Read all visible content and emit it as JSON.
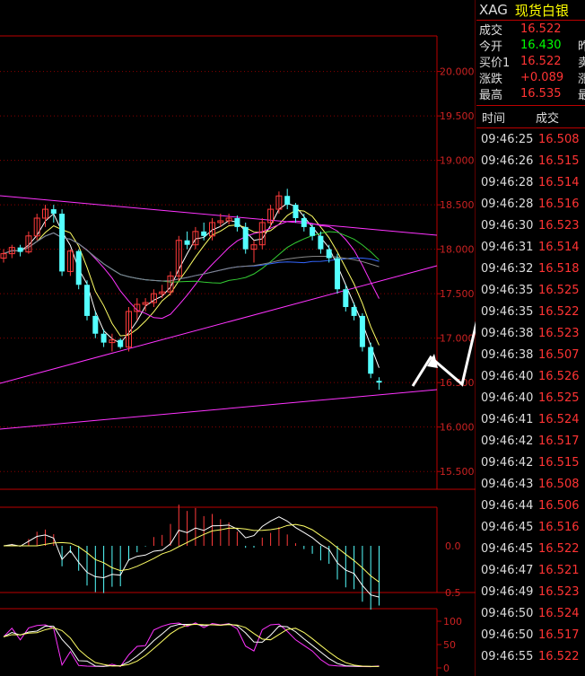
{
  "header": {
    "symbol": "XAG",
    "name": "现货白银"
  },
  "quote": [
    {
      "label": "成交",
      "value": "16.522",
      "color": "red",
      "extra": "",
      "name": "last"
    },
    {
      "label": "今开",
      "value": "16.430",
      "color": "green",
      "extra": "昨",
      "name": "open"
    },
    {
      "label": "买价1",
      "value": "16.522",
      "color": "red",
      "extra": "卖",
      "name": "bid"
    },
    {
      "label": "涨跌",
      "value": "+0.089",
      "color": "red",
      "extra": "涨",
      "name": "change"
    },
    {
      "label": "最高",
      "value": "16.535",
      "color": "red",
      "extra": "最",
      "name": "high"
    }
  ],
  "ticks_header": {
    "time": "时间",
    "price": "成交"
  },
  "ticks": [
    {
      "time": "09:46:25",
      "price": "16.508"
    },
    {
      "time": "09:46:26",
      "price": "16.515"
    },
    {
      "time": "09:46:28",
      "price": "16.514"
    },
    {
      "time": "09:46:28",
      "price": "16.516"
    },
    {
      "time": "09:46:30",
      "price": "16.523"
    },
    {
      "time": "09:46:31",
      "price": "16.514"
    },
    {
      "time": "09:46:32",
      "price": "16.518"
    },
    {
      "time": "09:46:35",
      "price": "16.525"
    },
    {
      "time": "09:46:35",
      "price": "16.522"
    },
    {
      "time": "09:46:38",
      "price": "16.523"
    },
    {
      "time": "09:46:38",
      "price": "16.507"
    },
    {
      "time": "09:46:40",
      "price": "16.526"
    },
    {
      "time": "09:46:40",
      "price": "16.525"
    },
    {
      "time": "09:46:41",
      "price": "16.524"
    },
    {
      "time": "09:46:42",
      "price": "16.517"
    },
    {
      "time": "09:46:42",
      "price": "16.515"
    },
    {
      "time": "09:46:43",
      "price": "16.508"
    },
    {
      "time": "09:46:44",
      "price": "16.506"
    },
    {
      "time": "09:46:45",
      "price": "16.516"
    },
    {
      "time": "09:46:45",
      "price": "16.522"
    },
    {
      "time": "09:46:47",
      "price": "16.521"
    },
    {
      "time": "09:46:49",
      "price": "16.523"
    },
    {
      "time": "09:46:50",
      "price": "16.524"
    },
    {
      "time": "09:46:50",
      "price": "16.517"
    },
    {
      "time": "09:46:55",
      "price": "16.522"
    }
  ],
  "chart_data": {
    "type": "candlestick",
    "price_axis": {
      "ticks": [
        "20.000",
        "19.500",
        "19.000",
        "18.500",
        "18.000",
        "17.500",
        "17.000",
        "16.500",
        "16.000",
        "15.500"
      ],
      "ylim": [
        15.3,
        20.4
      ]
    },
    "macd_axis": {
      "ticks": [
        "0.0",
        "0.5"
      ]
    },
    "kdj_axis": {
      "ticks": [
        "100",
        "50",
        "0"
      ]
    },
    "candles": [
      {
        "o": 17.9,
        "h": 18.0,
        "l": 17.85,
        "c": 17.95
      },
      {
        "o": 17.95,
        "h": 18.05,
        "l": 17.9,
        "c": 18.02
      },
      {
        "o": 18.02,
        "h": 18.05,
        "l": 17.92,
        "c": 17.97
      },
      {
        "o": 17.97,
        "h": 18.2,
        "l": 17.95,
        "c": 18.15
      },
      {
        "o": 18.15,
        "h": 18.4,
        "l": 18.1,
        "c": 18.35
      },
      {
        "o": 18.35,
        "h": 18.5,
        "l": 18.25,
        "c": 18.45
      },
      {
        "o": 18.45,
        "h": 18.5,
        "l": 18.3,
        "c": 18.4
      },
      {
        "o": 18.4,
        "h": 18.45,
        "l": 17.7,
        "c": 17.75
      },
      {
        "o": 17.75,
        "h": 18.0,
        "l": 17.7,
        "c": 17.98
      },
      {
        "o": 17.98,
        "h": 18.0,
        "l": 17.55,
        "c": 17.6
      },
      {
        "o": 17.6,
        "h": 17.65,
        "l": 17.2,
        "c": 17.25
      },
      {
        "o": 17.25,
        "h": 17.3,
        "l": 17.0,
        "c": 17.05
      },
      {
        "o": 17.05,
        "h": 17.1,
        "l": 16.9,
        "c": 16.95
      },
      {
        "o": 16.95,
        "h": 17.05,
        "l": 16.85,
        "c": 16.98
      },
      {
        "o": 16.98,
        "h": 17.0,
        "l": 16.88,
        "c": 16.9
      },
      {
        "o": 16.9,
        "h": 17.35,
        "l": 16.85,
        "c": 17.3
      },
      {
        "o": 17.3,
        "h": 17.45,
        "l": 17.2,
        "c": 17.38
      },
      {
        "o": 17.38,
        "h": 17.45,
        "l": 17.3,
        "c": 17.4
      },
      {
        "o": 17.4,
        "h": 17.55,
        "l": 17.35,
        "c": 17.5
      },
      {
        "o": 17.5,
        "h": 17.6,
        "l": 17.45,
        "c": 17.52
      },
      {
        "o": 17.52,
        "h": 17.75,
        "l": 17.48,
        "c": 17.7
      },
      {
        "o": 17.7,
        "h": 18.15,
        "l": 17.65,
        "c": 18.1
      },
      {
        "o": 18.1,
        "h": 18.2,
        "l": 18.0,
        "c": 18.05
      },
      {
        "o": 18.05,
        "h": 18.25,
        "l": 18.0,
        "c": 18.2
      },
      {
        "o": 18.2,
        "h": 18.3,
        "l": 18.1,
        "c": 18.15
      },
      {
        "o": 18.15,
        "h": 18.35,
        "l": 18.1,
        "c": 18.3
      },
      {
        "o": 18.3,
        "h": 18.4,
        "l": 18.25,
        "c": 18.32
      },
      {
        "o": 18.32,
        "h": 18.4,
        "l": 18.28,
        "c": 18.35
      },
      {
        "o": 18.35,
        "h": 18.38,
        "l": 18.2,
        "c": 18.25
      },
      {
        "o": 18.25,
        "h": 18.3,
        "l": 17.95,
        "c": 18.0
      },
      {
        "o": 18.0,
        "h": 18.1,
        "l": 17.85,
        "c": 18.05
      },
      {
        "o": 18.05,
        "h": 18.35,
        "l": 18.0,
        "c": 18.3
      },
      {
        "o": 18.3,
        "h": 18.5,
        "l": 18.25,
        "c": 18.45
      },
      {
        "o": 18.45,
        "h": 18.65,
        "l": 18.4,
        "c": 18.6
      },
      {
        "o": 18.6,
        "h": 18.68,
        "l": 18.45,
        "c": 18.5
      },
      {
        "o": 18.5,
        "h": 18.52,
        "l": 18.3,
        "c": 18.35
      },
      {
        "o": 18.35,
        "h": 18.4,
        "l": 18.2,
        "c": 18.25
      },
      {
        "o": 18.25,
        "h": 18.28,
        "l": 18.1,
        "c": 18.15
      },
      {
        "o": 18.15,
        "h": 18.2,
        "l": 17.95,
        "c": 18.0
      },
      {
        "o": 18.0,
        "h": 18.05,
        "l": 17.85,
        "c": 17.9
      },
      {
        "o": 17.9,
        "h": 17.95,
        "l": 17.5,
        "c": 17.55
      },
      {
        "o": 17.55,
        "h": 17.6,
        "l": 17.3,
        "c": 17.35
      },
      {
        "o": 17.35,
        "h": 17.4,
        "l": 17.2,
        "c": 17.25
      },
      {
        "o": 17.25,
        "h": 17.28,
        "l": 16.85,
        "c": 16.9
      },
      {
        "o": 16.9,
        "h": 16.95,
        "l": 16.55,
        "c": 16.6
      },
      {
        "o": 16.52,
        "h": 16.56,
        "l": 16.42,
        "c": 16.5
      }
    ]
  }
}
